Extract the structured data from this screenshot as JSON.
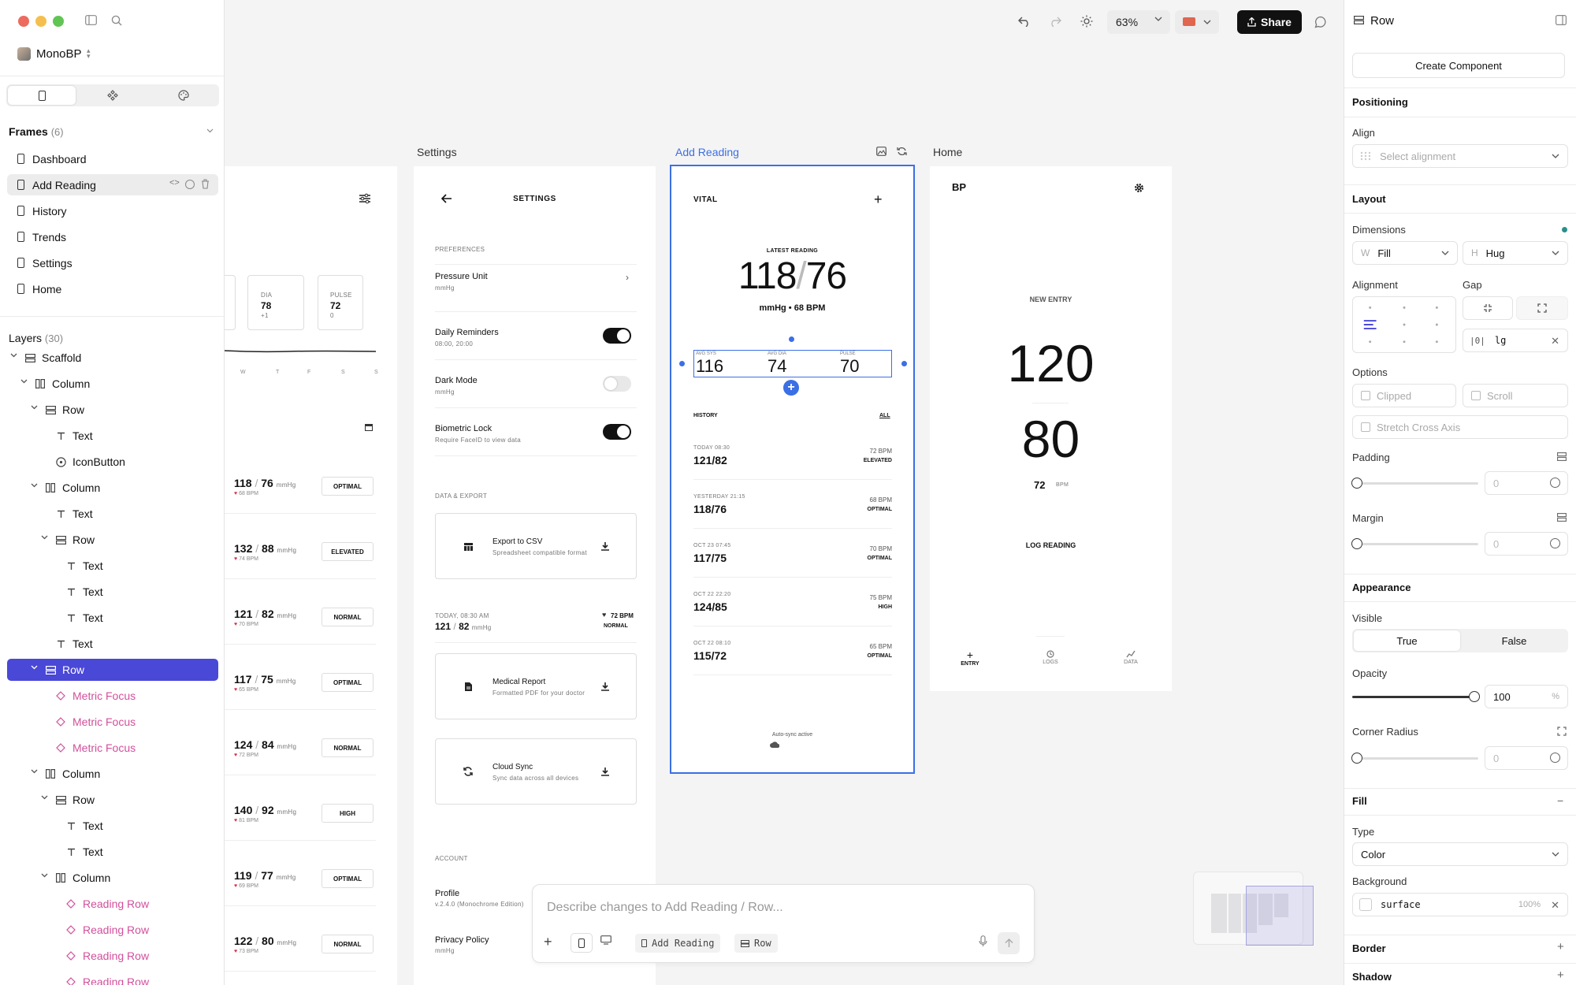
{
  "project": {
    "name": "MonoBP"
  },
  "frames": {
    "title": "Frames",
    "count": "(6)",
    "items": [
      "Dashboard",
      "Add Reading",
      "History",
      "Trends",
      "Settings",
      "Home"
    ]
  },
  "layers": {
    "title": "Layers",
    "count": "(30)",
    "items": [
      {
        "label": "Scaffold",
        "type": "row"
      },
      {
        "label": "Column",
        "type": "column"
      },
      {
        "label": "Row",
        "type": "row"
      },
      {
        "label": "Text",
        "type": "text"
      },
      {
        "label": "IconButton",
        "type": "iconbutton"
      },
      {
        "label": "Column",
        "type": "column"
      },
      {
        "label": "Text",
        "type": "text"
      },
      {
        "label": "Row",
        "type": "row"
      },
      {
        "label": "Text",
        "type": "text"
      },
      {
        "label": "Text",
        "type": "text"
      },
      {
        "label": "Text",
        "type": "text"
      },
      {
        "label": "Text",
        "type": "text"
      },
      {
        "label": "Row",
        "type": "row"
      },
      {
        "label": "Metric Focus",
        "type": "component"
      },
      {
        "label": "Metric Focus",
        "type": "component"
      },
      {
        "label": "Metric Focus",
        "type": "component"
      },
      {
        "label": "Column",
        "type": "column"
      },
      {
        "label": "Row",
        "type": "row"
      },
      {
        "label": "Text",
        "type": "text"
      },
      {
        "label": "Text",
        "type": "text"
      },
      {
        "label": "Column",
        "type": "column"
      },
      {
        "label": "Reading Row",
        "type": "component"
      },
      {
        "label": "Reading Row",
        "type": "component"
      },
      {
        "label": "Reading Row",
        "type": "component"
      },
      {
        "label": "Reading Row",
        "type": "component"
      }
    ]
  },
  "toolbar": {
    "zoom": "63%",
    "share": "Share"
  },
  "canvas": {
    "captions": {
      "settings": "Settings",
      "add_reading": "Add Reading",
      "home": "Home"
    },
    "dashboard": {
      "metrics": [
        {
          "label": "DIA",
          "value": "78",
          "delta": "+1"
        },
        {
          "label": "PULSE",
          "value": "72",
          "delta": "0"
        }
      ],
      "days": [
        "W",
        "T",
        "F",
        "S",
        "S"
      ],
      "unit": "mmHg",
      "readings": [
        {
          "sys": "118",
          "dia": "76",
          "bpm": "68 BPM",
          "status": "OPTIMAL"
        },
        {
          "sys": "132",
          "dia": "88",
          "bpm": "74 BPM",
          "status": "ELEVATED"
        },
        {
          "sys": "121",
          "dia": "82",
          "bpm": "70 BPM",
          "status": "NORMAL"
        },
        {
          "sys": "117",
          "dia": "75",
          "bpm": "65 BPM",
          "status": "OPTIMAL"
        },
        {
          "sys": "124",
          "dia": "84",
          "bpm": "72 BPM",
          "status": "NORMAL"
        },
        {
          "sys": "140",
          "dia": "92",
          "bpm": "81 BPM",
          "status": "HIGH"
        },
        {
          "sys": "119",
          "dia": "77",
          "bpm": "69 BPM",
          "status": "OPTIMAL"
        },
        {
          "sys": "122",
          "dia": "80",
          "bpm": "73 BPM",
          "status": "NORMAL"
        }
      ]
    },
    "settings": {
      "title": "SETTINGS",
      "preferences": "PREFERENCES",
      "pressure_unit": "Pressure Unit",
      "pressure_sub": "mmHg",
      "reminders": "Daily Reminders",
      "reminders_sub": "08:00, 20:00",
      "dark": "Dark Mode",
      "dark_sub": "mmHg",
      "bio": "Biometric Lock",
      "bio_sub": "Require FaceID to view data",
      "data_export": "DATA & EXPORT",
      "csv": "Export to CSV",
      "csv_sub": "Spreadsheet compatible format",
      "today": "TODAY, 08:30 AM",
      "today_bpm": "72 BPM",
      "today_sys": "121",
      "today_dia": "82",
      "today_unit": "mmHg",
      "today_status": "NORMAL",
      "medical": "Medical Report",
      "medical_sub": "Formatted PDF for your doctor",
      "cloud": "Cloud Sync",
      "cloud_sub": "Sync data across all devices",
      "account": "ACCOUNT",
      "profile": "Profile",
      "profile_sub": "v.2.4.0 (Monochrome Edition)",
      "privacy": "Privacy Policy",
      "privacy_sub": "mmHg"
    },
    "add_reading": {
      "title": "VITAL",
      "latest": "LATEST READING",
      "sys": "118",
      "dia": "76",
      "sub": "mmHg • 68 BPM",
      "metrics": [
        {
          "label": "AVG SYS",
          "value": "116"
        },
        {
          "label": "AVG DIA",
          "value": "74"
        },
        {
          "label": "PULSE",
          "value": "70"
        }
      ],
      "history": "HISTORY",
      "all": "ALL",
      "rows": [
        {
          "time": "TODAY 08:30",
          "value": "121/82",
          "bpm": "72 BPM",
          "status": "ELEVATED"
        },
        {
          "time": "YESTERDAY 21:15",
          "value": "118/76",
          "bpm": "68 BPM",
          "status": "OPTIMAL"
        },
        {
          "time": "OCT 23 07:45",
          "value": "117/75",
          "bpm": "70 BPM",
          "status": "OPTIMAL"
        },
        {
          "time": "OCT 22 22:20",
          "value": "124/85",
          "bpm": "75 BPM",
          "status": "HIGH"
        },
        {
          "time": "OCT 22 08:10",
          "value": "115/72",
          "bpm": "65 BPM",
          "status": "OPTIMAL"
        }
      ],
      "sync": "Auto-sync active"
    },
    "home": {
      "title": "BP",
      "new_entry": "NEW ENTRY",
      "sys": "120",
      "dia": "80",
      "pulse": "72",
      "bpm": "BPM",
      "log": "LOG READING",
      "nav": [
        "ENTRY",
        "LOGS",
        "DATA"
      ]
    }
  },
  "prompt": {
    "placeholder": "Describe changes to Add Reading / Row...",
    "chip_frame": "Add Reading",
    "chip_layer": "Row"
  },
  "inspector": {
    "title": "Row",
    "create": "Create Component",
    "positioning": "Positioning",
    "align": "Align",
    "align_placeholder": "Select alignment",
    "layout": "Layout",
    "dimensions": "Dimensions",
    "w_label": "W",
    "w_value": "Fill",
    "h_label": "H",
    "h_value": "Hug",
    "alignment": "Alignment",
    "gap": "Gap",
    "gap_value": "lg",
    "options": "Options",
    "clipped": "Clipped",
    "scroll": "Scroll",
    "stretch": "Stretch Cross Axis",
    "padding": "Padding",
    "padding_value": "0",
    "margin": "Margin",
    "margin_value": "0",
    "appearance": "Appearance",
    "visible": "Visible",
    "true": "True",
    "false": "False",
    "opacity": "Opacity",
    "opacity_value": "100",
    "opacity_pct": "%",
    "corner": "Corner Radius",
    "corner_value": "0",
    "fill": "Fill",
    "type": "Type",
    "type_value": "Color",
    "background": "Background",
    "bg_value": "surface",
    "bg_pct": "100%",
    "border": "Border",
    "shadow": "Shadow"
  },
  "colors": {
    "accent": "#4a48d6",
    "selection": "#3b6fe6",
    "pink": "#d34f9b",
    "teal": "#2a8f8a",
    "heart": "#d6334a"
  }
}
